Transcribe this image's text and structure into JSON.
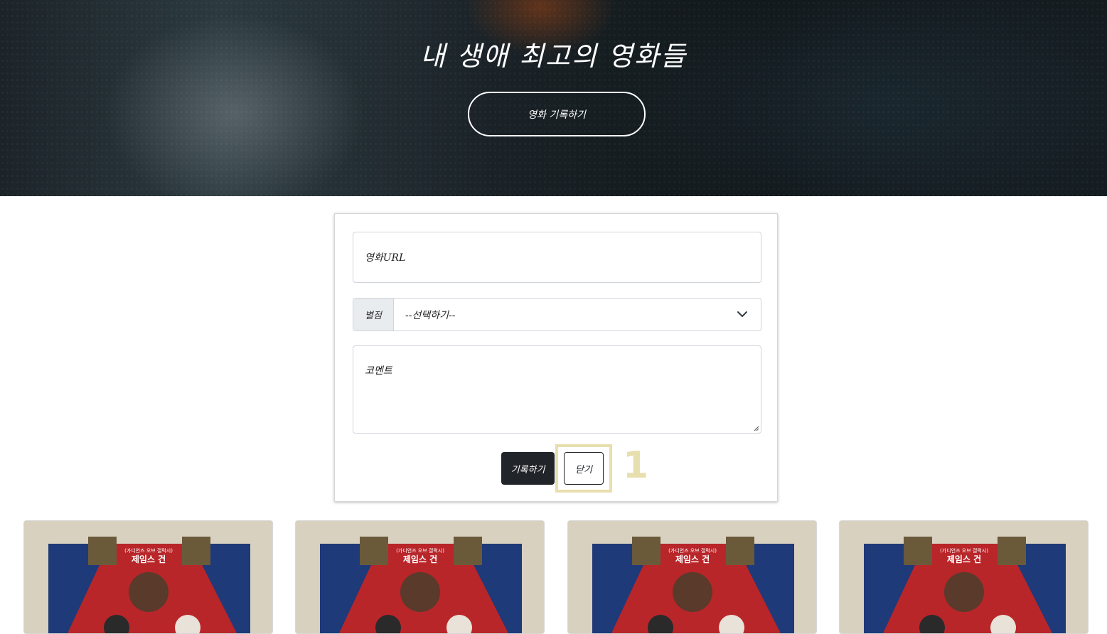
{
  "hero": {
    "title": "내 생애 최고의 영화들",
    "open_form_button": "영화 기록하기"
  },
  "form": {
    "url_placeholder": "영화URL",
    "rating": {
      "label": "별점",
      "selected": "--선택하기--"
    },
    "comment_placeholder": "코멘트",
    "save_button": "기록하기",
    "close_button": "닫기"
  },
  "annotation": {
    "marker": "1",
    "color": "#e8dfae"
  },
  "posters": [
    {
      "top_text": "(가디언즈 오브 갤럭시)",
      "director": "제임스 건"
    },
    {
      "top_text": "(가디언즈 오브 갤럭시)",
      "director": "제임스 건"
    },
    {
      "top_text": "(가디언즈 오브 갤럭시)",
      "director": "제임스 건"
    },
    {
      "top_text": "(가디언즈 오브 갤럭시)",
      "director": "제임스 건"
    }
  ],
  "colors": {
    "dark_button": "#212529",
    "input_border": "#cfd4da",
    "prefix_bg": "#e9ecef"
  }
}
